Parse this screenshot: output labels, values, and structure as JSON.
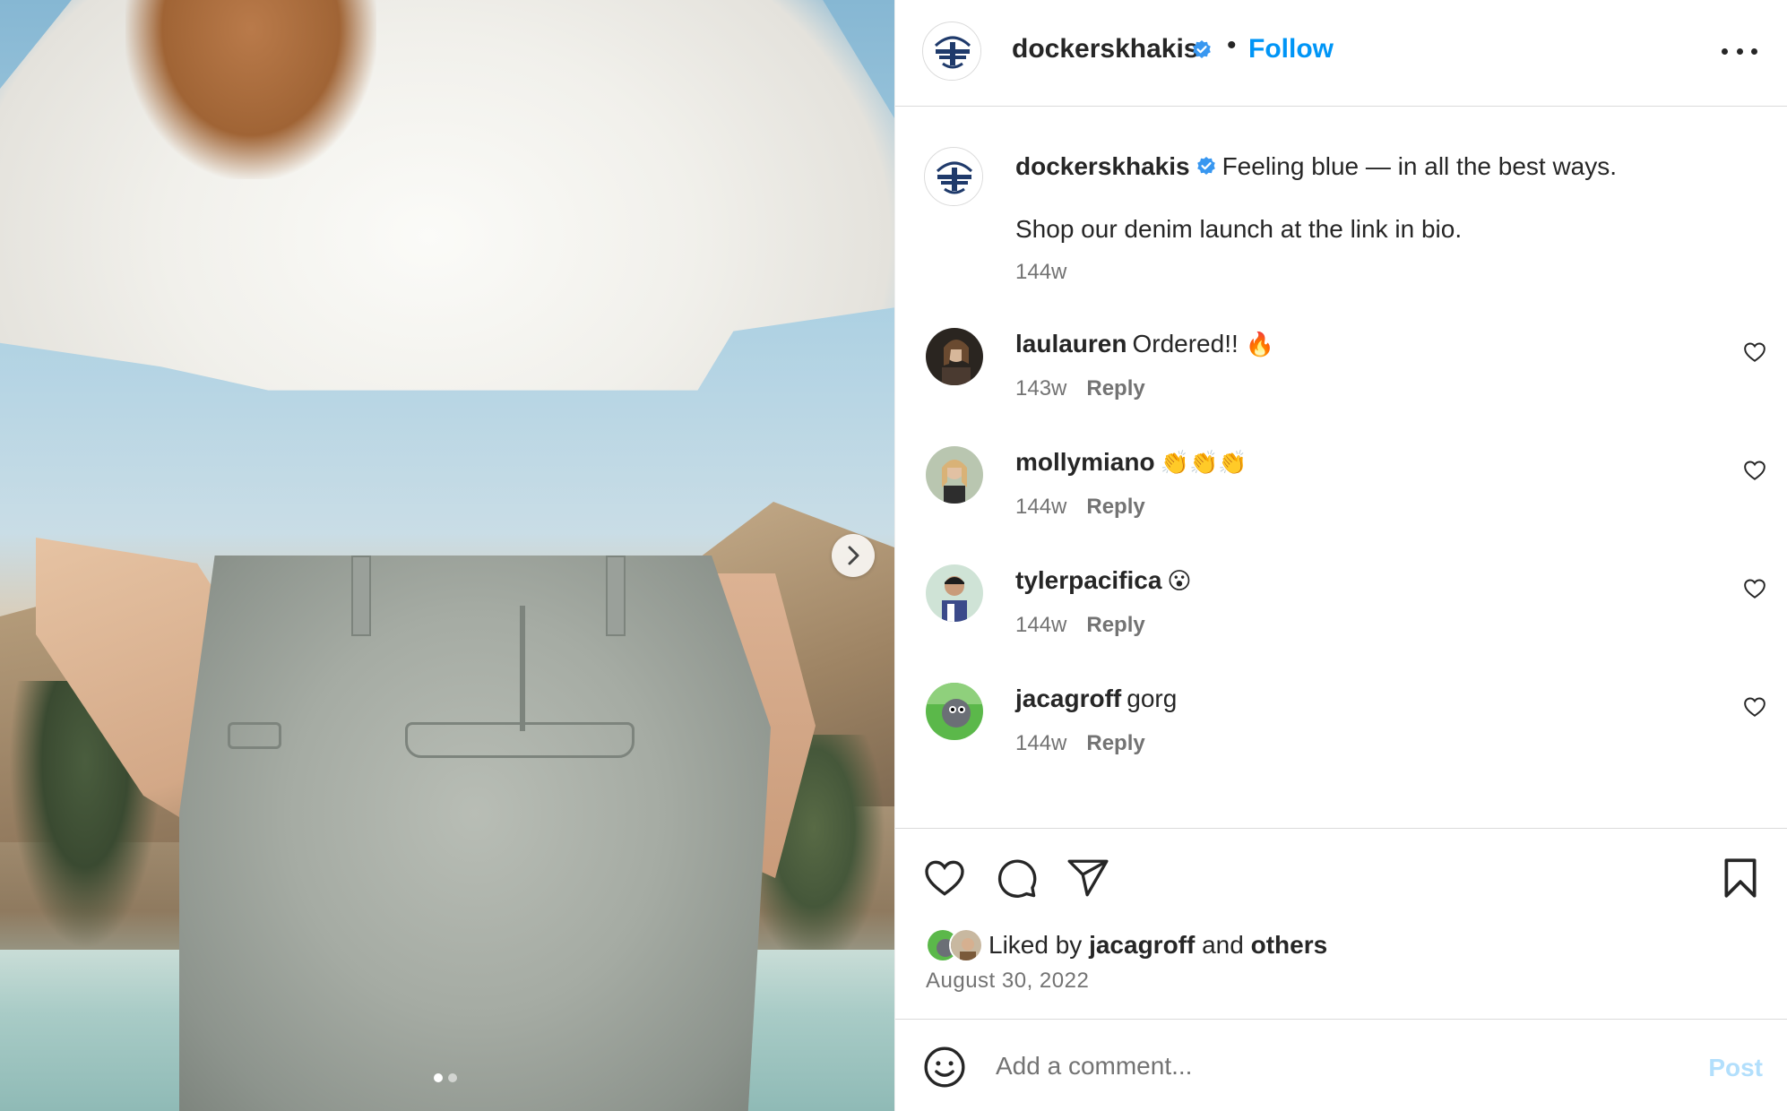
{
  "post": {
    "username": "dockerskhakis",
    "separator": "•",
    "follow_label": "Follow",
    "more_icon": "more-horizontal-icon"
  },
  "caption": {
    "username": "dockerskhakis",
    "text_line1": "Feeling blue — in all the best ways.",
    "text_line2": "Shop our denim launch at the link in bio.",
    "timestamp": "144w"
  },
  "comments": [
    {
      "username": "laulauren",
      "text": "Ordered!!",
      "emoji": "🔥",
      "timestamp": "143w",
      "reply_label": "Reply"
    },
    {
      "username": "mollymiano",
      "text": "",
      "emoji": "👏👏👏",
      "timestamp": "144w",
      "reply_label": "Reply"
    },
    {
      "username": "tylerpacifica",
      "text": "",
      "emoji": "😮",
      "timestamp": "144w",
      "reply_label": "Reply"
    },
    {
      "username": "jacagroff",
      "text": "gorg",
      "emoji": "",
      "timestamp": "144w",
      "reply_label": "Reply"
    }
  ],
  "likes": {
    "prefix": "Liked by",
    "user": "jacagroff",
    "middle": "and",
    "others": "others"
  },
  "date": "August 30, 2022",
  "add_comment": {
    "placeholder": "Add a comment...",
    "post_label": "Post"
  },
  "carousel": {
    "slide_count": 2,
    "active_index": 0
  },
  "colors": {
    "accent": "#0095f6",
    "verified": "#3897f0",
    "post_disabled": "#b2dffc",
    "muted_text": "#737373"
  }
}
